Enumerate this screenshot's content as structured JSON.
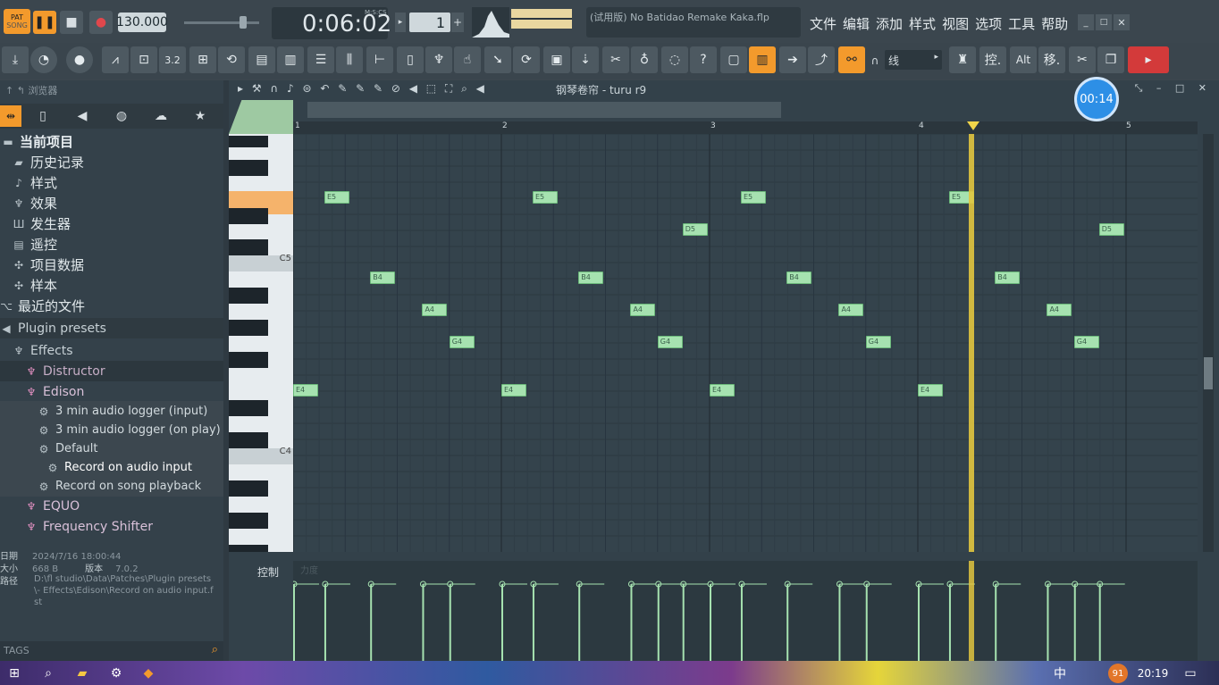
{
  "transport": {
    "pat": "PAT",
    "song": "SONG",
    "tempo": "130.000",
    "time": "0:06:02",
    "time_label": "M:S:CS",
    "pattern": "1"
  },
  "project": {
    "title": "(试用版) No Batidao Remake Kaka.flp"
  },
  "menu": [
    "文件",
    "编辑",
    "添加",
    "样式",
    "视图",
    "选项",
    "工具",
    "帮助"
  ],
  "toolbar": {
    "snap": "线",
    "ctrl_label": "控.",
    "alt_label": "Alt",
    "move_label": "移."
  },
  "browser": {
    "title": "浏览器",
    "items": [
      {
        "label": "当前项目",
        "icon": "folder-icon"
      },
      {
        "label": "历史记录",
        "icon": "history-icon"
      },
      {
        "label": "样式",
        "icon": "note-icon"
      },
      {
        "label": "效果",
        "icon": "plug-icon"
      },
      {
        "label": "发生器",
        "icon": "keyboard-icon"
      },
      {
        "label": "遥控",
        "icon": "remote-icon"
      },
      {
        "label": "项目数据",
        "icon": "data-icon"
      },
      {
        "label": "样本",
        "icon": "sample-icon"
      },
      {
        "label": "最近的文件",
        "icon": "recent-icon"
      },
      {
        "label": "Plugin presets",
        "icon": "speaker-icon"
      },
      {
        "label": "Effects",
        "icon": "plug-icon"
      },
      {
        "label": "Distructor",
        "icon": "plug-icon"
      },
      {
        "label": "Edison",
        "icon": "plug-icon"
      },
      {
        "label": "3 min audio logger (input)",
        "icon": "gear-icon"
      },
      {
        "label": "3 min audio logger (on play)",
        "icon": "gear-icon"
      },
      {
        "label": "Default",
        "icon": "gear-icon"
      },
      {
        "label": "Record on audio input",
        "icon": "gear-icon"
      },
      {
        "label": "Record on song playback",
        "icon": "gear-icon"
      },
      {
        "label": "EQUO",
        "icon": "plug-icon"
      },
      {
        "label": "Frequency Shifter",
        "icon": "plug-icon"
      }
    ],
    "info": {
      "date_label": "日期",
      "date": "2024/7/16 18:00:44",
      "size_label": "大小",
      "size": "668 B",
      "version_label": "版本",
      "version": "7.0.2",
      "path_label": "路径",
      "path": "D:\\fl studio\\Data\\Patches\\Plugin presets\\- Effects\\Edison\\Record on audio input.fst"
    },
    "tags": "TAGS"
  },
  "piano_roll": {
    "title": "钢琴卷帘 - turu r9",
    "timer": "00:14",
    "bars": [
      "1",
      "2",
      "3",
      "4",
      "5"
    ],
    "key_labels": [
      "C5",
      "C4"
    ],
    "control_label": "控制",
    "control_sub": "力度",
    "notes": [
      {
        "label": "E5",
        "bar": 1.15,
        "row": "E5"
      },
      {
        "label": "B4",
        "bar": 1.37,
        "row": "B4"
      },
      {
        "label": "A4",
        "bar": 1.62,
        "row": "A4"
      },
      {
        "label": "G4",
        "bar": 1.75,
        "row": "G4"
      },
      {
        "label": "E4",
        "bar": 1.0,
        "row": "E4"
      },
      {
        "label": "E5",
        "bar": 2.15,
        "row": "E5"
      },
      {
        "label": "B4",
        "bar": 2.37,
        "row": "B4"
      },
      {
        "label": "A4",
        "bar": 2.62,
        "row": "A4"
      },
      {
        "label": "G4",
        "bar": 2.75,
        "row": "G4"
      },
      {
        "label": "E4",
        "bar": 2.0,
        "row": "E4"
      },
      {
        "label": "D5",
        "bar": 2.87,
        "row": "D5"
      },
      {
        "label": "E5",
        "bar": 3.15,
        "row": "E5"
      },
      {
        "label": "B4",
        "bar": 3.37,
        "row": "B4"
      },
      {
        "label": "A4",
        "bar": 3.62,
        "row": "A4"
      },
      {
        "label": "G4",
        "bar": 3.75,
        "row": "G4"
      },
      {
        "label": "E4",
        "bar": 3.0,
        "row": "E4"
      },
      {
        "label": "E5",
        "bar": 4.15,
        "row": "E5"
      },
      {
        "label": "B4",
        "bar": 4.37,
        "row": "B4"
      },
      {
        "label": "A4",
        "bar": 4.62,
        "row": "A4"
      },
      {
        "label": "G4",
        "bar": 4.75,
        "row": "G4"
      },
      {
        "label": "E4",
        "bar": 4.0,
        "row": "E4"
      },
      {
        "label": "D5",
        "bar": 4.87,
        "row": "D5"
      }
    ]
  },
  "taskbar": {
    "lang": "中",
    "time": "20:19",
    "badge": "91"
  }
}
